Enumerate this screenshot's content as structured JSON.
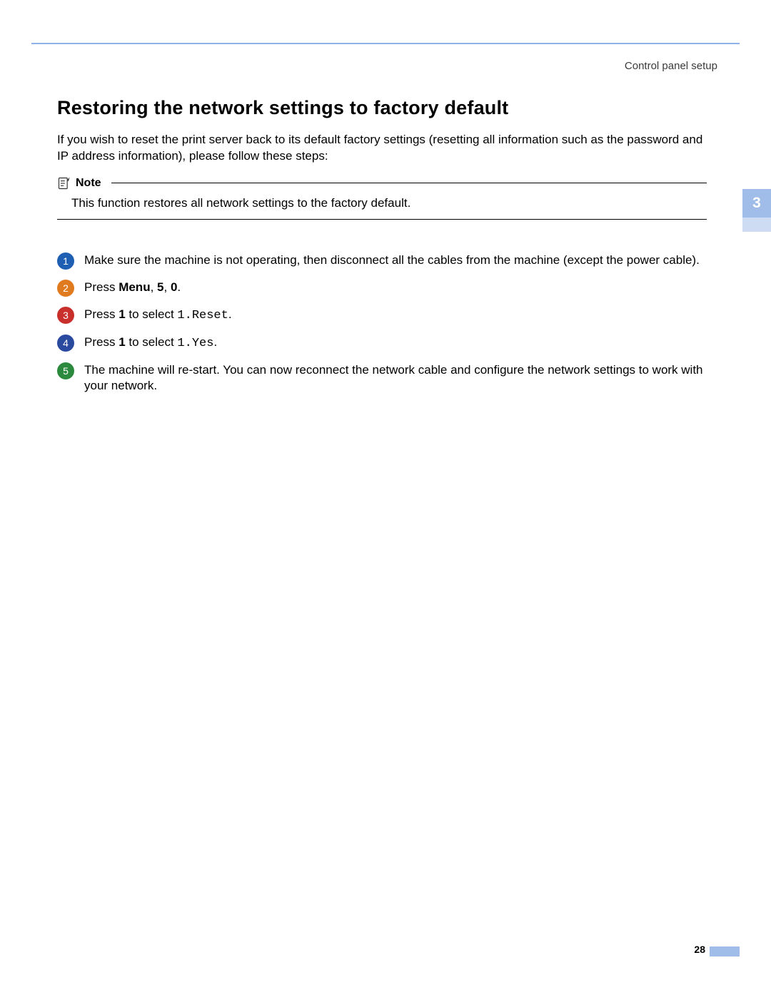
{
  "breadcrumb": "Control panel setup",
  "chapter_tab": "3",
  "page_number": "28",
  "title": "Restoring the network settings to factory default",
  "intro": "If you wish to reset the print server back to its default factory settings (resetting all information such as the password and IP address information), please follow these steps:",
  "note": {
    "label": "Note",
    "body": "This function restores all network settings to the factory default."
  },
  "steps": [
    {
      "num": "1",
      "color": "c-blue",
      "plain": "Make sure the machine is not operating, then disconnect all the cables from the machine (except the power cable)."
    },
    {
      "num": "2",
      "color": "c-orange",
      "pre": "Press ",
      "bold1": "Menu",
      "mid1": ", ",
      "bold2": "5",
      "mid2": ", ",
      "bold3": "0",
      "post": "."
    },
    {
      "num": "3",
      "color": "c-red",
      "pre": "Press ",
      "bold1": "1",
      "mid1": " to select ",
      "mono1": "1.Reset",
      "post": "."
    },
    {
      "num": "4",
      "color": "c-navy",
      "pre": "Press ",
      "bold1": "1",
      "mid1": " to select ",
      "mono1": "1.Yes",
      "post": "."
    },
    {
      "num": "5",
      "color": "c-green",
      "plain": "The machine will re-start. You can now reconnect the network cable and configure the network settings to work with your network."
    }
  ]
}
